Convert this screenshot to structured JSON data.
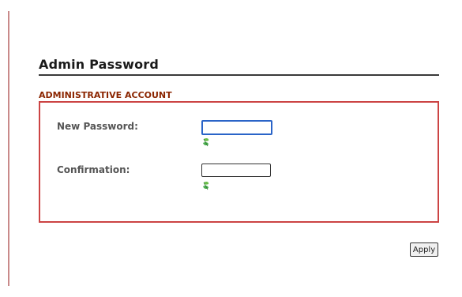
{
  "page": {
    "title": "Admin Password"
  },
  "section": {
    "title": "ADMINISTRATIVE ACCOUNT"
  },
  "fields": {
    "new_password": {
      "label": "New Password:",
      "value": ""
    },
    "confirmation": {
      "label": "Confirmation:",
      "value": ""
    }
  },
  "actions": {
    "apply_label": "Apply"
  },
  "icons": {
    "new_password_hint": "leaf-icon",
    "confirmation_hint": "leaf-icon"
  },
  "colors": {
    "section_title": "#8b2500",
    "section_border": "#cc4444",
    "focused_input_border": "#2a64c8",
    "hint_icon": "#4caf50"
  }
}
